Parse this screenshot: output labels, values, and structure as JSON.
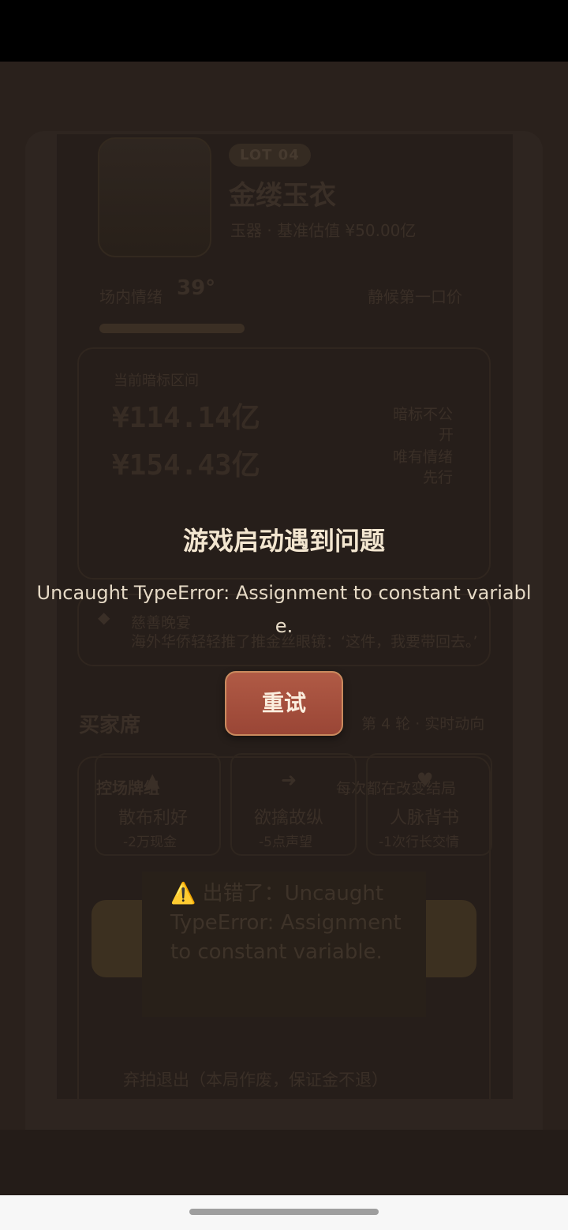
{
  "underlay": {
    "lot_badge": "LOT 04",
    "lot_title": "金缕玉衣",
    "lot_subtitle": "玉器 · 基准估值 ¥50.00亿",
    "mood_label": "场内情绪",
    "mood_value": "39°",
    "waiting_label": "静候第一口价",
    "bid_range_label": "当前暗标区间",
    "bid_low": "¥114.14亿",
    "bid_high": "¥154.43亿",
    "bid_note_1": "暗标不公",
    "bid_note_2": "开",
    "bid_note_3": "唯有情绪",
    "bid_note_4": "先行",
    "event_title": "慈善晚宴",
    "event_text": "海外华侨轻轻推了推金丝眼镜：‘这件，我要带回去。’",
    "buyer_section": "买家席",
    "round_info": "第 4 轮 · 实时动向",
    "control_group": "控场牌组",
    "control_hint": "每次都在改变结局",
    "actions": [
      {
        "title": "散布利好",
        "cost": "-2万现金"
      },
      {
        "title": "欲擒故纵",
        "cost": "-5点声望"
      },
      {
        "title": "人脉背书",
        "cost": "-1次行长交情"
      }
    ],
    "toast": "⚠️ 出错了：Uncaught TypeError: Assignment to constant variable.",
    "quit_label": "弃拍退出（本局作废，保证金不退）"
  },
  "modal": {
    "title": "游戏启动遇到问题",
    "message": "Uncaught TypeError: Assignment to constant variable.",
    "retry_label": "重试"
  },
  "colors": {
    "accent": "#a9503d",
    "background": "#231b17"
  }
}
